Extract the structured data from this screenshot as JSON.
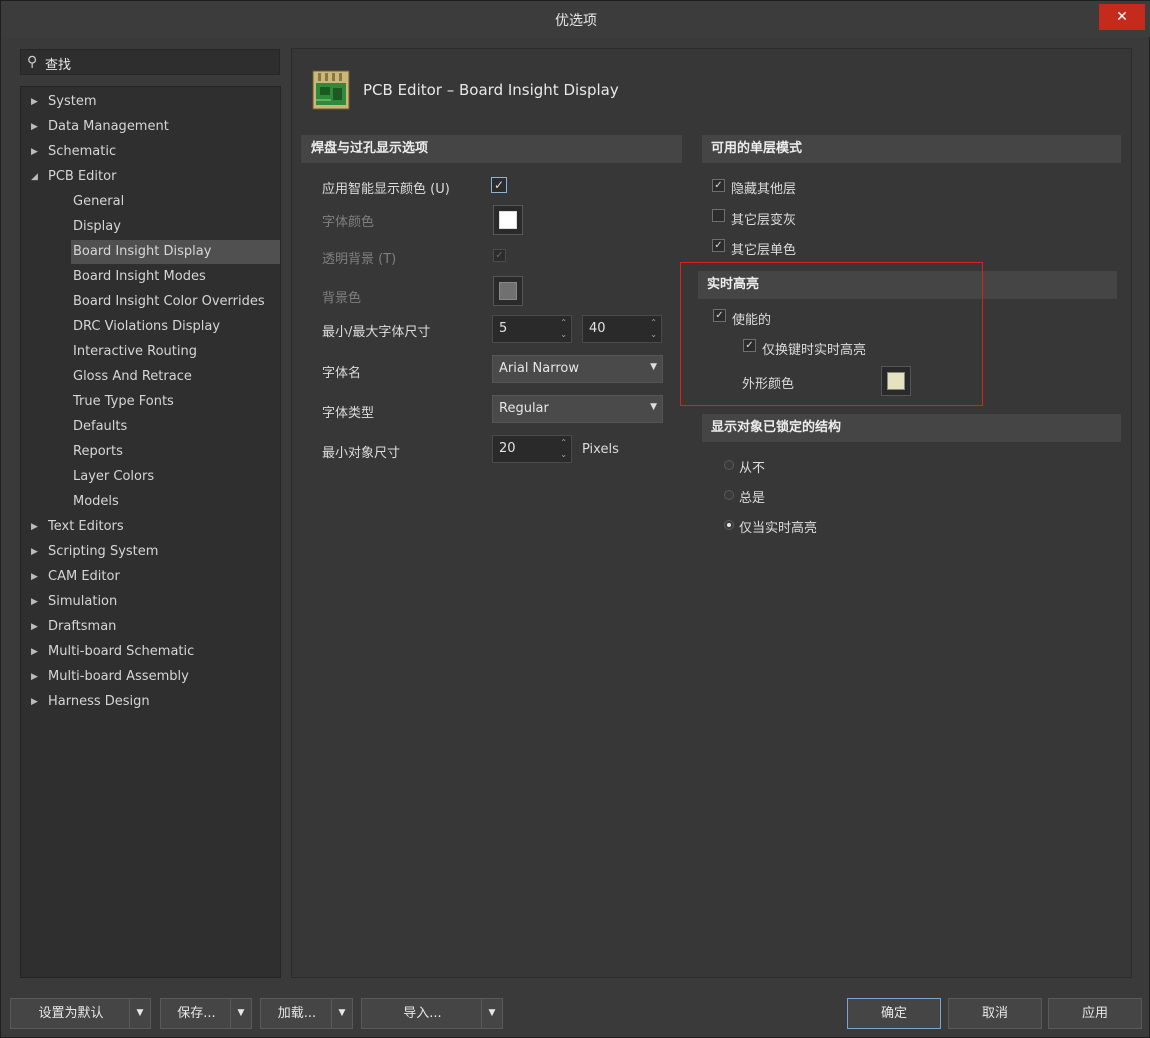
{
  "window": {
    "title": "优选项",
    "close_symbol": "✕"
  },
  "search": {
    "placeholder": "查找"
  },
  "tree": {
    "items": [
      {
        "label": "System",
        "level": 0,
        "expandable": true
      },
      {
        "label": "Data Management",
        "level": 0,
        "expandable": true
      },
      {
        "label": "Schematic",
        "level": 0,
        "expandable": true
      },
      {
        "label": "PCB Editor",
        "level": 0,
        "expanded": true
      },
      {
        "label": "General",
        "level": 1
      },
      {
        "label": "Display",
        "level": 1
      },
      {
        "label": "Board Insight Display",
        "level": 1,
        "selected": true
      },
      {
        "label": "Board Insight Modes",
        "level": 1
      },
      {
        "label": "Board Insight Color Overrides",
        "level": 1
      },
      {
        "label": "DRC Violations Display",
        "level": 1
      },
      {
        "label": "Interactive Routing",
        "level": 1
      },
      {
        "label": "Gloss And Retrace",
        "level": 1
      },
      {
        "label": "True Type Fonts",
        "level": 1
      },
      {
        "label": "Defaults",
        "level": 1
      },
      {
        "label": "Reports",
        "level": 1
      },
      {
        "label": "Layer Colors",
        "level": 1
      },
      {
        "label": "Models",
        "level": 1
      },
      {
        "label": "Text Editors",
        "level": 0,
        "expandable": true
      },
      {
        "label": "Scripting System",
        "level": 0,
        "expandable": true
      },
      {
        "label": "CAM Editor",
        "level": 0,
        "expandable": true
      },
      {
        "label": "Simulation",
        "level": 0,
        "expandable": true
      },
      {
        "label": "Draftsman",
        "level": 0,
        "expandable": true
      },
      {
        "label": "Multi-board Schematic",
        "level": 0,
        "expandable": true
      },
      {
        "label": "Multi-board Assembly",
        "level": 0,
        "expandable": true
      },
      {
        "label": "Harness Design",
        "level": 0,
        "expandable": true
      }
    ]
  },
  "page": {
    "title": "PCB Editor – Board Insight Display"
  },
  "pad_via": {
    "section": "焊盘与过孔显示选项",
    "smart_color_label": "应用智能显示颜色 (U)",
    "smart_color_checked": true,
    "font_color_label": "字体颜色",
    "font_color": "#ffffff",
    "transparent_bg_label": "透明背景 (T)",
    "transparent_bg_checked": true,
    "bg_color_label": "背景色",
    "bg_color": "#707070",
    "font_size_label": "最小/最大字体尺寸",
    "font_min": "5",
    "font_max": "40",
    "font_name_label": "字体名",
    "font_name": "Arial Narrow",
    "font_style_label": "字体类型",
    "font_style": "Regular",
    "min_obj_label": "最小对象尺寸",
    "min_obj_value": "20",
    "min_obj_unit": "Pixels"
  },
  "single_layer": {
    "section": "可用的单层模式",
    "options": [
      {
        "label": "隐藏其他层",
        "checked": true
      },
      {
        "label": "其它层变灰",
        "checked": false
      },
      {
        "label": "其它层单色",
        "checked": true
      }
    ]
  },
  "live_highlight": {
    "section": "实时高亮",
    "enabled_label": "使能的",
    "enabled_checked": true,
    "shift_only_label": "仅换键时实时高亮",
    "shift_only_checked": true,
    "outline_color_label": "外形颜色",
    "outline_color": "#e6e2c0"
  },
  "locked_structure": {
    "section": "显示对象已锁定的结构",
    "options": [
      {
        "label": "从不",
        "selected": false
      },
      {
        "label": "总是",
        "selected": false
      },
      {
        "label": "仅当实时高亮",
        "selected": true
      }
    ]
  },
  "footer": {
    "set_default": "设置为默认",
    "save": "保存...",
    "load": "加载...",
    "import": "导入...",
    "ok": "确定",
    "cancel": "取消",
    "apply": "应用"
  }
}
